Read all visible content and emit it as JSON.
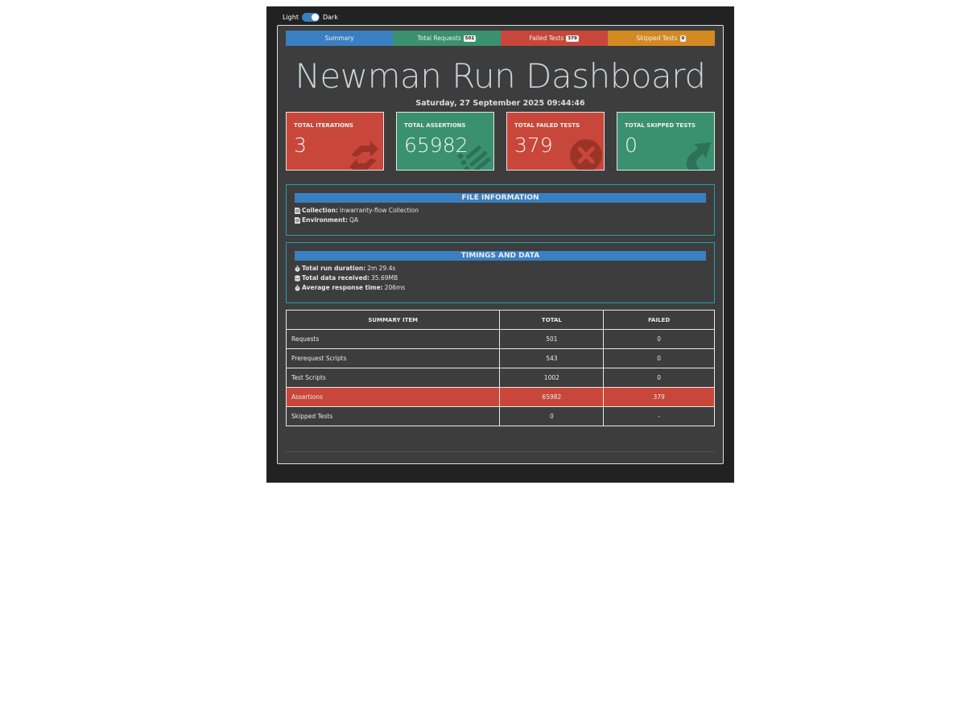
{
  "theme": {
    "light_label": "Light",
    "dark_label": "Dark"
  },
  "tabs": [
    {
      "label": "Summary",
      "badge": "",
      "color": "#3a7fc1"
    },
    {
      "label": "Total Requests",
      "badge": "501",
      "color": "#3a9170"
    },
    {
      "label": "Failed Tests",
      "badge": "379",
      "color": "#c8473a"
    },
    {
      "label": "Skipped Tests",
      "badge": "0",
      "color": "#d48a23"
    }
  ],
  "page_title": "Newman Run Dashboard",
  "run_date": "Saturday, 27 September 2025 09:44:46",
  "cards": [
    {
      "label": "TOTAL ITERATIONS",
      "value": "3",
      "color": "#c8473a",
      "icon": "refresh-icon"
    },
    {
      "label": "TOTAL ASSERTIONS",
      "value": "65982",
      "color": "#3a9170",
      "icon": "list-check-icon"
    },
    {
      "label": "TOTAL FAILED TESTS",
      "value": "379",
      "color": "#c8473a",
      "icon": "error-icon"
    },
    {
      "label": "TOTAL SKIPPED TESTS",
      "value": "0",
      "color": "#3a9170",
      "icon": "redo-arrow-icon"
    }
  ],
  "file_info": {
    "heading": "FILE INFORMATION",
    "collection_label": "Collection:",
    "collection_value": "Inwarranty-flow Collection",
    "environment_label": "Environment:",
    "environment_value": "QA"
  },
  "timings": {
    "heading": "TIMINGS AND DATA",
    "duration_label": "Total run duration:",
    "duration_value": "2m 29.4s",
    "data_label": "Total data received:",
    "data_value": "35.69MB",
    "response_label": "Average response time:",
    "response_value": "206ms"
  },
  "summary_table": {
    "headers": [
      "SUMMARY ITEM",
      "TOTAL",
      "FAILED"
    ],
    "rows": [
      {
        "item": "Requests",
        "total": "501",
        "failed": "0"
      },
      {
        "item": "Prerequest Scripts",
        "total": "543",
        "failed": "0"
      },
      {
        "item": "Test Scripts",
        "total": "1002",
        "failed": "0"
      },
      {
        "item": "Assertions",
        "total": "65982",
        "failed": "379"
      },
      {
        "item": "Skipped Tests",
        "total": "0",
        "failed": "-"
      }
    ]
  }
}
